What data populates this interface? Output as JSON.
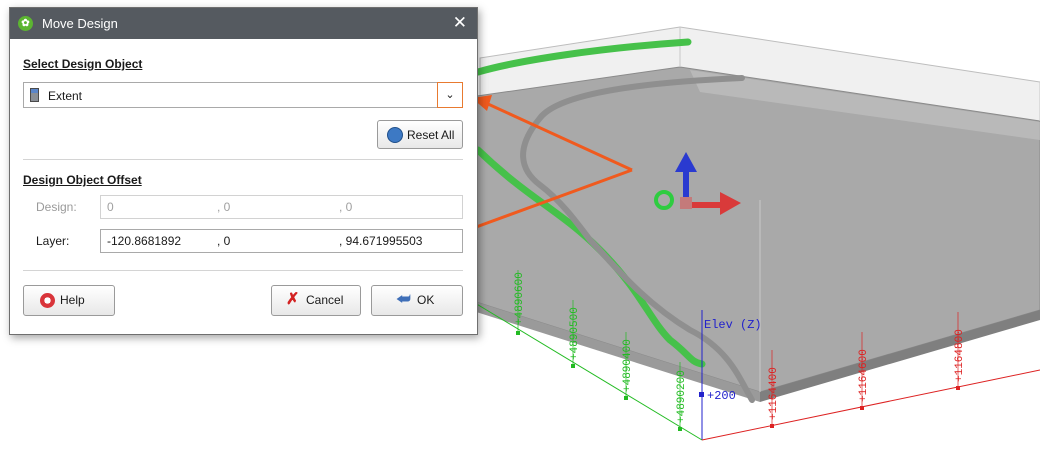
{
  "window": {
    "title": "Move Design",
    "close_glyph": "✕",
    "title_icon": "leapfrog-logo-icon"
  },
  "select_design_object": {
    "heading": "Select Design Object",
    "value": "Extent",
    "icon": "extent-icon",
    "dropdown_glyph": "⌄"
  },
  "reset_button": {
    "label": "Reset All",
    "icon": "reset-icon"
  },
  "offset": {
    "heading": "Design Object Offset",
    "design": {
      "label": "Design:",
      "x": "0",
      "y": ", 0",
      "z": ", 0"
    },
    "layer": {
      "label": "Layer:",
      "x": "-120.8681892",
      "y": ", 0",
      "z": ", 94.671995503"
    }
  },
  "buttons": {
    "help": "Help",
    "cancel": "Cancel",
    "ok": "OK"
  },
  "scene": {
    "axis_title": "Elev (Z)",
    "elev_tick": "+200",
    "y_ticks": [
      "+4890600",
      "+4890500",
      "+4890400",
      "+4890200"
    ],
    "x_ticks": [
      "+1164400",
      "+1164600",
      "+1164800"
    ],
    "colors": {
      "green_axis": "#22bb22",
      "red_axis": "#dd2222",
      "blue_axis": "#2222cc",
      "arrow": "#f05a1e",
      "green_tube": "#46c14a",
      "gray_tube": "#8f8f8f"
    }
  }
}
